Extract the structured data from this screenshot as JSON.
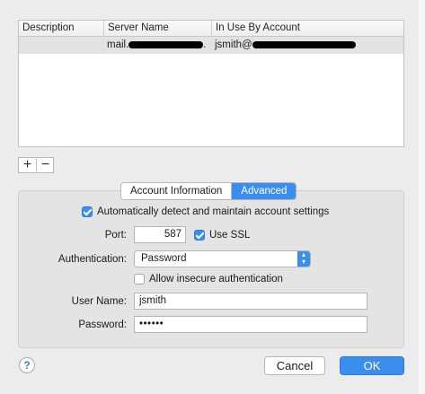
{
  "server_table": {
    "columns": [
      "Description",
      "Server Name",
      "In Use By Account"
    ],
    "rows": [
      {
        "description": "",
        "server_prefix": "mail.",
        "server_suffix": ".",
        "account_prefix": "jsmith@"
      }
    ]
  },
  "list_controls": {
    "add": "+",
    "remove": "−"
  },
  "tabs": {
    "account_information": "Account Information",
    "advanced": "Advanced"
  },
  "auto_detect": {
    "label": "Automatically detect and maintain account settings",
    "checked": true
  },
  "port": {
    "label": "Port:",
    "value": "587"
  },
  "use_ssl": {
    "label": "Use SSL",
    "checked": true
  },
  "authentication": {
    "label": "Authentication:",
    "value": "Password"
  },
  "allow_insecure": {
    "label": "Allow insecure authentication",
    "checked": false
  },
  "user_name": {
    "label": "User Name:",
    "value": "jsmith"
  },
  "password": {
    "label": "Password:",
    "value": "••••••"
  },
  "footer": {
    "help": "?",
    "cancel": "Cancel",
    "ok": "OK"
  },
  "colors": {
    "accent": "#3b8ef0",
    "background": "#ececec",
    "panel": "#e4e4e4"
  }
}
